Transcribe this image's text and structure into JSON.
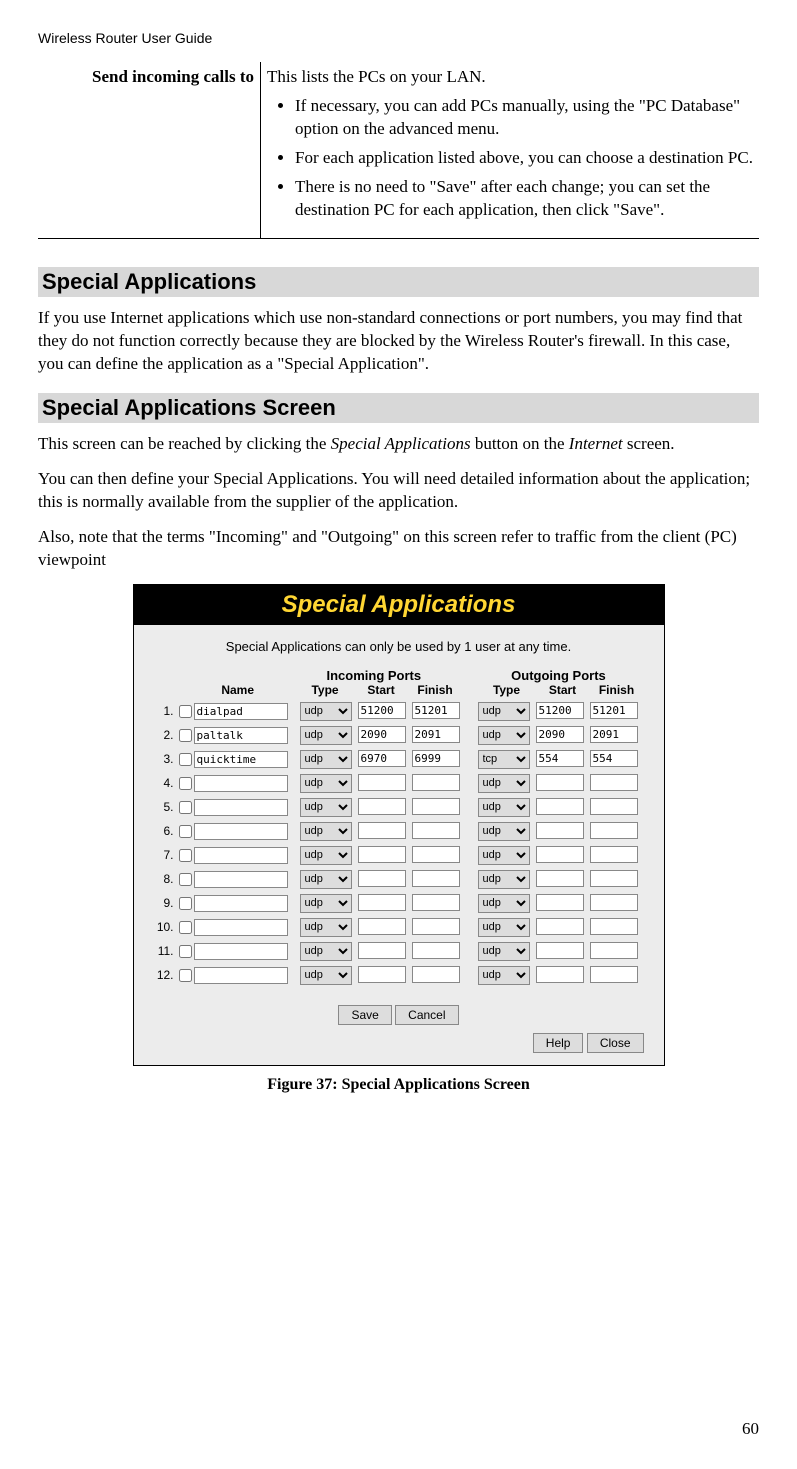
{
  "doc_header": "Wireless Router User Guide",
  "table_row": {
    "term": "Send incoming calls to",
    "intro": "This lists the PCs on your LAN.",
    "bullets": [
      "If necessary, you can add PCs manually, using the \"PC Database\" option on the advanced menu.",
      "For each application listed above, you can choose a destination PC.",
      "There is no need to \"Save\" after each change; you can set the destination PC for each application, then click \"Save\"."
    ]
  },
  "heading1": "Special Applications",
  "para1": "If you use Internet applications which use non-standard connections or port numbers, you may find that they do not function correctly because they are blocked by the Wireless Router's firewall. In this case, you can define the application as a \"Special Application\".",
  "heading2": "Special Applications Screen",
  "para2_a": "This screen can be reached by clicking the ",
  "para2_b": " button on the ",
  "para2_c": " screen.",
  "para2_em1": "Special Applications",
  "para2_em2": "Internet",
  "para3": "You can then define your Special Applications. You will need detailed information about the application; this is normally available from the supplier of the application.",
  "para4": "Also, note that the terms \"Incoming\" and \"Outgoing\" on this screen refer to traffic from the client (PC) viewpoint",
  "router": {
    "title": "Special Applications",
    "note": "Special Applications can only be used by 1 user at any time.",
    "labels": {
      "name": "Name",
      "incoming": "Incoming Ports",
      "outgoing": "Outgoing Ports",
      "type": "Type",
      "start": "Start",
      "finish": "Finish"
    },
    "proto_options": [
      "udp",
      "tcp"
    ],
    "rows": [
      {
        "n": "1.",
        "name": "dialpad",
        "in_type": "udp",
        "in_start": "51200",
        "in_finish": "51201",
        "out_type": "udp",
        "out_start": "51200",
        "out_finish": "51201"
      },
      {
        "n": "2.",
        "name": "paltalk",
        "in_type": "udp",
        "in_start": "2090",
        "in_finish": "2091",
        "out_type": "udp",
        "out_start": "2090",
        "out_finish": "2091"
      },
      {
        "n": "3.",
        "name": "quicktime",
        "in_type": "udp",
        "in_start": "6970",
        "in_finish": "6999",
        "out_type": "tcp",
        "out_start": "554",
        "out_finish": "554"
      },
      {
        "n": "4.",
        "name": "",
        "in_type": "udp",
        "in_start": "",
        "in_finish": "",
        "out_type": "udp",
        "out_start": "",
        "out_finish": ""
      },
      {
        "n": "5.",
        "name": "",
        "in_type": "udp",
        "in_start": "",
        "in_finish": "",
        "out_type": "udp",
        "out_start": "",
        "out_finish": ""
      },
      {
        "n": "6.",
        "name": "",
        "in_type": "udp",
        "in_start": "",
        "in_finish": "",
        "out_type": "udp",
        "out_start": "",
        "out_finish": ""
      },
      {
        "n": "7.",
        "name": "",
        "in_type": "udp",
        "in_start": "",
        "in_finish": "",
        "out_type": "udp",
        "out_start": "",
        "out_finish": ""
      },
      {
        "n": "8.",
        "name": "",
        "in_type": "udp",
        "in_start": "",
        "in_finish": "",
        "out_type": "udp",
        "out_start": "",
        "out_finish": ""
      },
      {
        "n": "9.",
        "name": "",
        "in_type": "udp",
        "in_start": "",
        "in_finish": "",
        "out_type": "udp",
        "out_start": "",
        "out_finish": ""
      },
      {
        "n": "10.",
        "name": "",
        "in_type": "udp",
        "in_start": "",
        "in_finish": "",
        "out_type": "udp",
        "out_start": "",
        "out_finish": ""
      },
      {
        "n": "11.",
        "name": "",
        "in_type": "udp",
        "in_start": "",
        "in_finish": "",
        "out_type": "udp",
        "out_start": "",
        "out_finish": ""
      },
      {
        "n": "12.",
        "name": "",
        "in_type": "udp",
        "in_start": "",
        "in_finish": "",
        "out_type": "udp",
        "out_start": "",
        "out_finish": ""
      }
    ],
    "buttons": {
      "save": "Save",
      "cancel": "Cancel",
      "help": "Help",
      "close": "Close"
    }
  },
  "fig_caption": "Figure 37: Special Applications Screen",
  "page_number": "60"
}
